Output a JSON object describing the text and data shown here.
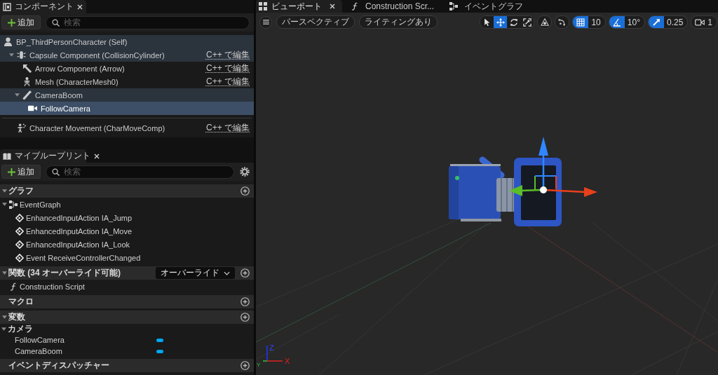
{
  "components_panel": {
    "tab": {
      "label": "コンポーネント"
    },
    "add_button": {
      "label": "追加"
    },
    "search": {
      "placeholder": "検索"
    },
    "tree": [
      {
        "label": "BP_ThirdPersonCharacter (Self)",
        "kind": "actor",
        "selected": false,
        "children": [
          {
            "label": "Capsule Component (CollisionCylinder)",
            "kind": "capsule",
            "selected": false,
            "expanded": true,
            "edit_link": "C++ で編集",
            "children": [
              {
                "label": "Arrow Component (Arrow)",
                "kind": "arrow",
                "selected": false,
                "edit_link": "C++ で編集"
              },
              {
                "label": "Mesh (CharacterMesh0)",
                "kind": "mesh",
                "selected": false,
                "edit_link": "C++ で編集"
              },
              {
                "label": "CameraBoom",
                "kind": "spring_arm",
                "selected": false,
                "expanded": true,
                "children": [
                  {
                    "label": "FollowCamera",
                    "kind": "camera",
                    "selected": true
                  }
                ]
              }
            ]
          }
        ]
      }
    ],
    "other_components": [
      {
        "label": "Character Movement (CharMoveComp)",
        "kind": "movement",
        "selected": false,
        "edit_link": "C++ で編集"
      }
    ]
  },
  "blueprint_panel": {
    "tab": {
      "label": "マイブループリント"
    },
    "add_button": {
      "label": "追加"
    },
    "search": {
      "placeholder": "検索"
    },
    "sections": [
      {
        "title": "グラフ",
        "expanded": true,
        "items": [
          {
            "label": "EventGraph",
            "kind": "graph",
            "expanded": true,
            "children": [
              {
                "label": "EnhancedInputAction IA_Jump",
                "kind": "event"
              },
              {
                "label": "EnhancedInputAction IA_Move",
                "kind": "event"
              },
              {
                "label": "EnhancedInputAction IA_Look",
                "kind": "event"
              },
              {
                "label": "Event ReceiveControllerChanged",
                "kind": "event"
              }
            ]
          }
        ]
      },
      {
        "title": "関数 (34 オーバーライド可能)",
        "expanded": true,
        "dropdown": "オーバーライド",
        "items": [
          {
            "label": "Construction Script",
            "kind": "function"
          }
        ]
      },
      {
        "title": "マクロ"
      },
      {
        "title": "変数",
        "expanded": true,
        "categories": [
          {
            "label": "カメラ",
            "expanded": true,
            "items": [
              {
                "label": "FollowCamera"
              },
              {
                "label": "CameraBoom"
              }
            ]
          }
        ]
      },
      {
        "title": "イベントディスパッチャー"
      }
    ]
  },
  "viewport": {
    "tabs": [
      {
        "label": "ビューポート",
        "kind": "viewport",
        "selected": true
      },
      {
        "label": "Construction Scr...",
        "kind": "function",
        "selected": false
      },
      {
        "label": "イベントグラフ",
        "kind": "graph",
        "selected": false
      }
    ],
    "toolbar": {
      "view_mode": "パースペクティブ",
      "lighting_mode": "ライティングあり",
      "transform_tools": [
        {
          "kind": "select",
          "selected": false
        },
        {
          "kind": "translate",
          "selected": true
        },
        {
          "kind": "rotate",
          "selected": false
        },
        {
          "kind": "scale",
          "selected": false
        }
      ],
      "snaps": [
        {
          "kind": "grid",
          "on": true,
          "value": "10"
        },
        {
          "kind": "rotation",
          "on": true,
          "value": "10°"
        },
        {
          "kind": "scale",
          "on": true,
          "value": "0.25"
        }
      ],
      "camera_speed": "1"
    },
    "axis_indicator": {
      "z": "Z",
      "y": "Y",
      "x": "X"
    }
  }
}
